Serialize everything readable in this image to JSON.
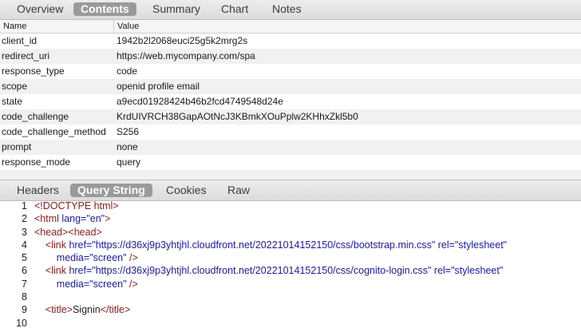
{
  "top_tabs": [
    "Overview",
    "Contents",
    "Summary",
    "Chart",
    "Notes"
  ],
  "top_active": "Contents",
  "table": {
    "headers": [
      "Name",
      "Value"
    ],
    "rows": [
      [
        "client_id",
        "1942b2l2068euci25g5k2mrg2s"
      ],
      [
        "redirect_uri",
        "https://web.mycompany.com/spa"
      ],
      [
        "response_type",
        "code"
      ],
      [
        "scope",
        "openid profile email"
      ],
      [
        "state",
        "a9ecd01928424b46b2fcd4749548d24e"
      ],
      [
        "code_challenge",
        "KrdUIVRCH38GapAOtNcJ3KBmkXOuPplw2KHhxZkl5b0"
      ],
      [
        "code_challenge_method",
        "S256"
      ],
      [
        "prompt",
        "none"
      ],
      [
        "response_mode",
        "query"
      ]
    ]
  },
  "sub_tabs": [
    "Headers",
    "Query String",
    "Cookies",
    "Raw"
  ],
  "sub_active": "Query String",
  "code_lines": [
    {
      "n": "1",
      "parts": [
        [
          "t",
          "<!DOCTYPE html>"
        ]
      ]
    },
    {
      "n": "2",
      "parts": [
        [
          "t",
          "<html "
        ],
        [
          "at",
          "lang="
        ],
        [
          "at",
          "\"en\""
        ],
        [
          "t",
          ">"
        ]
      ]
    },
    {
      "n": "3",
      "parts": [
        [
          "t",
          "<head><head>"
        ]
      ]
    },
    {
      "n": "4",
      "parts": [
        [
          "plain",
          "    "
        ],
        [
          "t",
          "<link "
        ],
        [
          "at",
          "href="
        ],
        [
          "at",
          "\"https://d36xj9p3yhtjhl.cloudfront.net/20221014152150/css/bootstrap.min.css\""
        ],
        [
          "plain",
          " "
        ],
        [
          "at",
          "rel="
        ],
        [
          "at",
          "\"stylesheet\""
        ]
      ]
    },
    {
      "n": "5",
      "parts": [
        [
          "plain",
          "        "
        ],
        [
          "at",
          "media="
        ],
        [
          "at",
          "\"screen\""
        ],
        [
          "t",
          " />"
        ]
      ]
    },
    {
      "n": "6",
      "parts": [
        [
          "plain",
          "    "
        ],
        [
          "t",
          "<link "
        ],
        [
          "at",
          "href="
        ],
        [
          "at",
          "\"https://d36xj9p3yhtjhl.cloudfront.net/20221014152150/css/cognito-login.css\""
        ],
        [
          "plain",
          " "
        ],
        [
          "at",
          "rel="
        ],
        [
          "at",
          "\"stylesheet\""
        ]
      ]
    },
    {
      "n": "7",
      "parts": [
        [
          "plain",
          "        "
        ],
        [
          "at",
          "media="
        ],
        [
          "at",
          "\"screen\""
        ],
        [
          "t",
          " />"
        ]
      ]
    },
    {
      "n": "8",
      "parts": []
    },
    {
      "n": "9",
      "parts": [
        [
          "plain",
          "    "
        ],
        [
          "t",
          "<title>"
        ],
        [
          "plain",
          "Signin"
        ],
        [
          "t",
          "</title>"
        ]
      ]
    },
    {
      "n": "10",
      "parts": []
    }
  ]
}
